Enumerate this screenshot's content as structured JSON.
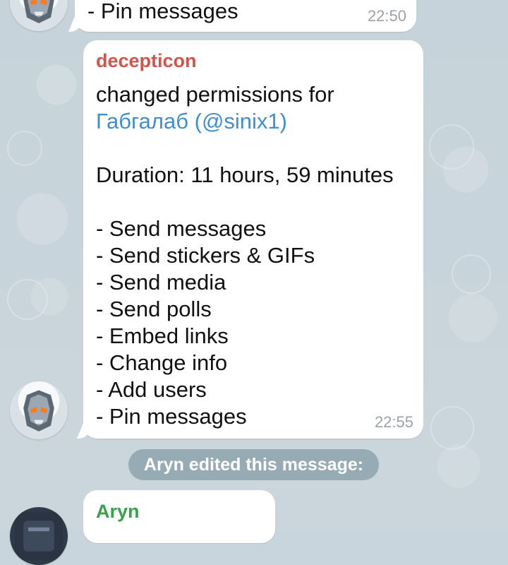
{
  "top_message": {
    "line": "- Pin messages",
    "time": "22:50"
  },
  "main_message": {
    "sender": "decepticon",
    "line1": "changed permissions for",
    "user_name": "Габгалаб",
    "user_handle": "(@sinix1)",
    "duration": "Duration: 11 hours, 59 minutes",
    "permissions": [
      "- Send messages",
      "- Send stickers & GIFs",
      "- Send media",
      "- Send polls",
      "- Embed links",
      "- Change info",
      "- Add users",
      "- Pin messages"
    ],
    "time": "22:55"
  },
  "service_message": {
    "text": "Aryn edited this message:"
  },
  "aryn_message": {
    "sender": "Aryn"
  },
  "colors": {
    "sender_red": "#d0554a",
    "sender_green": "#3aa24d",
    "link_blue": "#3f8fd0",
    "time_gray": "#9aa3ab",
    "bubble_white": "#ffffff",
    "service_bg": "#7e96a0"
  },
  "icons": {
    "avatar_top": "robot-avatar-icon",
    "avatar_main": "robot-avatar-icon",
    "avatar_bottom": "dark-avatar-icon"
  }
}
